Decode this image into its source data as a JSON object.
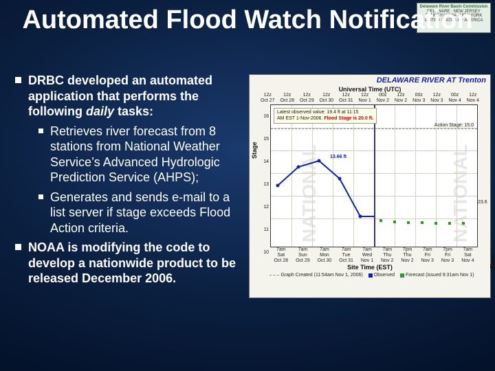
{
  "logo": {
    "line1": "Delaware River Basin Commission",
    "line2": "DELAWARE · NEW JERSEY",
    "line3": "PENNSYLVANIA · NEW YORK",
    "line4": "UNITED STATES OF AMERICA"
  },
  "title": "Automated Flood Watch Notification",
  "bullets": {
    "b1_pre": "DRBC developed an automated application that performs the following ",
    "b1_ital": "daily",
    "b1_post": " tasks:",
    "b1a": "Retrieves river forecast from 8 stations from National Weather Service’s Advanced Hydrologic Prediction Service (AHPS);",
    "b1b": "Generates and sends e-mail to a list server if stage exceeds Flood Action criteria.",
    "b2": "NOAA is modifying the code to develop a nationwide product to be released December 2006."
  },
  "chart": {
    "title": "DELAWARE RIVER  AT Trenton",
    "utc_label": "Universal Time (UTC)",
    "utc_ticks": [
      {
        "t": "12z",
        "d": "Oct 27"
      },
      {
        "t": "12z",
        "d": "Oct 28"
      },
      {
        "t": "12z",
        "d": "Oct 29"
      },
      {
        "t": "12z",
        "d": "Oct 30"
      },
      {
        "t": "12z",
        "d": "Oct 31"
      },
      {
        "t": "12z",
        "d": "Nov 1"
      },
      {
        "t": "00z",
        "d": "Nov 2"
      },
      {
        "t": "12z",
        "d": "Nov 2"
      },
      {
        "t": "00z",
        "d": "Nov 3"
      },
      {
        "t": "12z",
        "d": "Nov 3"
      },
      {
        "t": "00z",
        "d": "Nov 4"
      },
      {
        "t": "12z",
        "d": "Nov 4"
      }
    ],
    "obs_box_l1": "Latest observed value: 19.4 ft at 11:15",
    "obs_box_l2_a": "AM EST 1-Nov-2006. ",
    "obs_box_l2_b": "Flood Stage is 20.0 ft.",
    "action_label": "Action Stage: 15.0",
    "center_value": "13.66 ft",
    "y_left_label": "Stage",
    "y_right_label": "Flow",
    "y_left_ticks": [
      "10",
      "11",
      "12",
      "13",
      "14",
      "15",
      "16"
    ],
    "y_right_ticks": [
      "23.6",
      "",
      "",
      "",
      "",
      "",
      ""
    ],
    "site_label": "Site Time (EST)",
    "x_ticks": [
      {
        "t": "7am",
        "d": "Sat",
        "dd": "Oct 28"
      },
      {
        "t": "7am",
        "d": "Sun",
        "dd": "Oct 29"
      },
      {
        "t": "7am",
        "d": "Mon",
        "dd": "Oct 30"
      },
      {
        "t": "7am",
        "d": "Tue",
        "dd": "Oct 31"
      },
      {
        "t": "7am",
        "d": "Wed",
        "dd": "Nov 1"
      },
      {
        "t": "7am",
        "d": "Thu",
        "dd": "Nov 2"
      },
      {
        "t": "7pm",
        "d": "Thu",
        "dd": "Nov 2"
      },
      {
        "t": "7am",
        "d": "Fri",
        "dd": "Nov 3"
      },
      {
        "t": "7pm",
        "d": "Fri",
        "dd": "Nov 3"
      },
      {
        "t": "7am",
        "d": "Sat",
        "dd": "Nov 4"
      }
    ],
    "legend_graph": "Graph Created (11:54am Nov 1, 2006)",
    "legend_obs": "Observed",
    "legend_fc": "Forecast (issued 9:31am Nov 1)",
    "watermark": "NATIONAL"
  },
  "chart_data": {
    "type": "line",
    "title": "DELAWARE RIVER AT Trenton",
    "xlabel": "Site Time (EST)",
    "ylabel": "Stage (ft)",
    "ylim": [
      10,
      16
    ],
    "action_stage": 15.0,
    "flood_stage": 20.0,
    "latest_observed": {
      "value_ft": 19.4,
      "time": "11:15 AM EST 1-Nov-2006"
    },
    "noted_value_ft": 13.66,
    "series": [
      {
        "name": "Observed",
        "color": "#1020b0",
        "x": [
          "Oct 28 7am",
          "Oct 29 7am",
          "Oct 30 7am",
          "Oct 31 7am",
          "Nov 1 7am"
        ],
        "y": [
          12.6,
          13.4,
          13.66,
          12.9,
          11.3
        ]
      },
      {
        "name": "Forecast",
        "color": "#2a9a2a",
        "x": [
          "Nov 1 7am",
          "Nov 2 7am",
          "Nov 2 7pm",
          "Nov 3 7am",
          "Nov 3 7pm",
          "Nov 4 7am"
        ],
        "y": [
          11.3,
          11.1,
          11.0,
          11.0,
          10.9,
          10.9
        ]
      }
    ]
  }
}
